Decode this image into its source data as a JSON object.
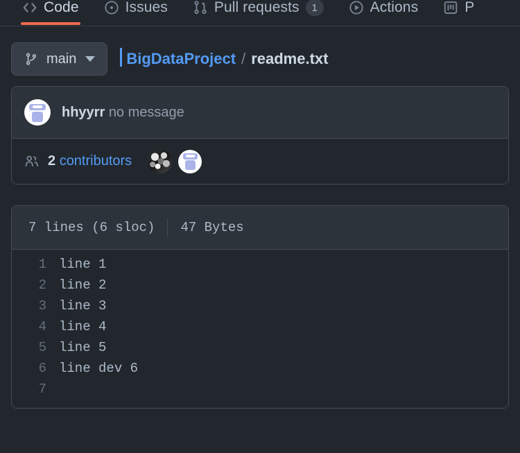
{
  "nav": {
    "tabs": [
      {
        "label": "Code",
        "icon": "code-icon",
        "active": true,
        "count": null
      },
      {
        "label": "Issues",
        "icon": "issue-opened-icon",
        "active": false,
        "count": null
      },
      {
        "label": "Pull requests",
        "icon": "git-pull-request-icon",
        "active": false,
        "count": "1"
      },
      {
        "label": "Actions",
        "icon": "play-icon",
        "active": false,
        "count": null
      },
      {
        "label": "P",
        "icon": "project-icon",
        "active": false,
        "count": null
      }
    ],
    "active_underline_color": "#ef6b4d"
  },
  "file_head": {
    "branch_button": {
      "icon": "git-branch-icon",
      "label": "main",
      "caret": "chevron-down-icon"
    },
    "breadcrumb": {
      "repo": "BigDataProject",
      "separator": "/",
      "file": "readme.txt"
    }
  },
  "commit": {
    "avatar": "user-avatar",
    "author": "hhyyrr",
    "message": "no message"
  },
  "contributors": {
    "icon": "people-icon",
    "count": "2",
    "label": "contributors",
    "avatars": [
      "contributor-avatar-noise",
      "contributor-avatar-user"
    ]
  },
  "code": {
    "meta": {
      "lines": "7 lines (6 sloc)",
      "size": "47 Bytes"
    },
    "lines": [
      {
        "number": "1",
        "text": "line 1"
      },
      {
        "number": "2",
        "text": "line 2"
      },
      {
        "number": "3",
        "text": "line 3"
      },
      {
        "number": "4",
        "text": "line 4"
      },
      {
        "number": "5",
        "text": "line 5"
      },
      {
        "number": "6",
        "text": "line dev 6"
      },
      {
        "number": "7",
        "text": ""
      }
    ]
  },
  "colors": {
    "page_bg": "#22272e",
    "panel_bg": "#2d333b",
    "border": "#444c56",
    "accent_link": "#539bf5",
    "accent_active": "#ef6b4d"
  }
}
